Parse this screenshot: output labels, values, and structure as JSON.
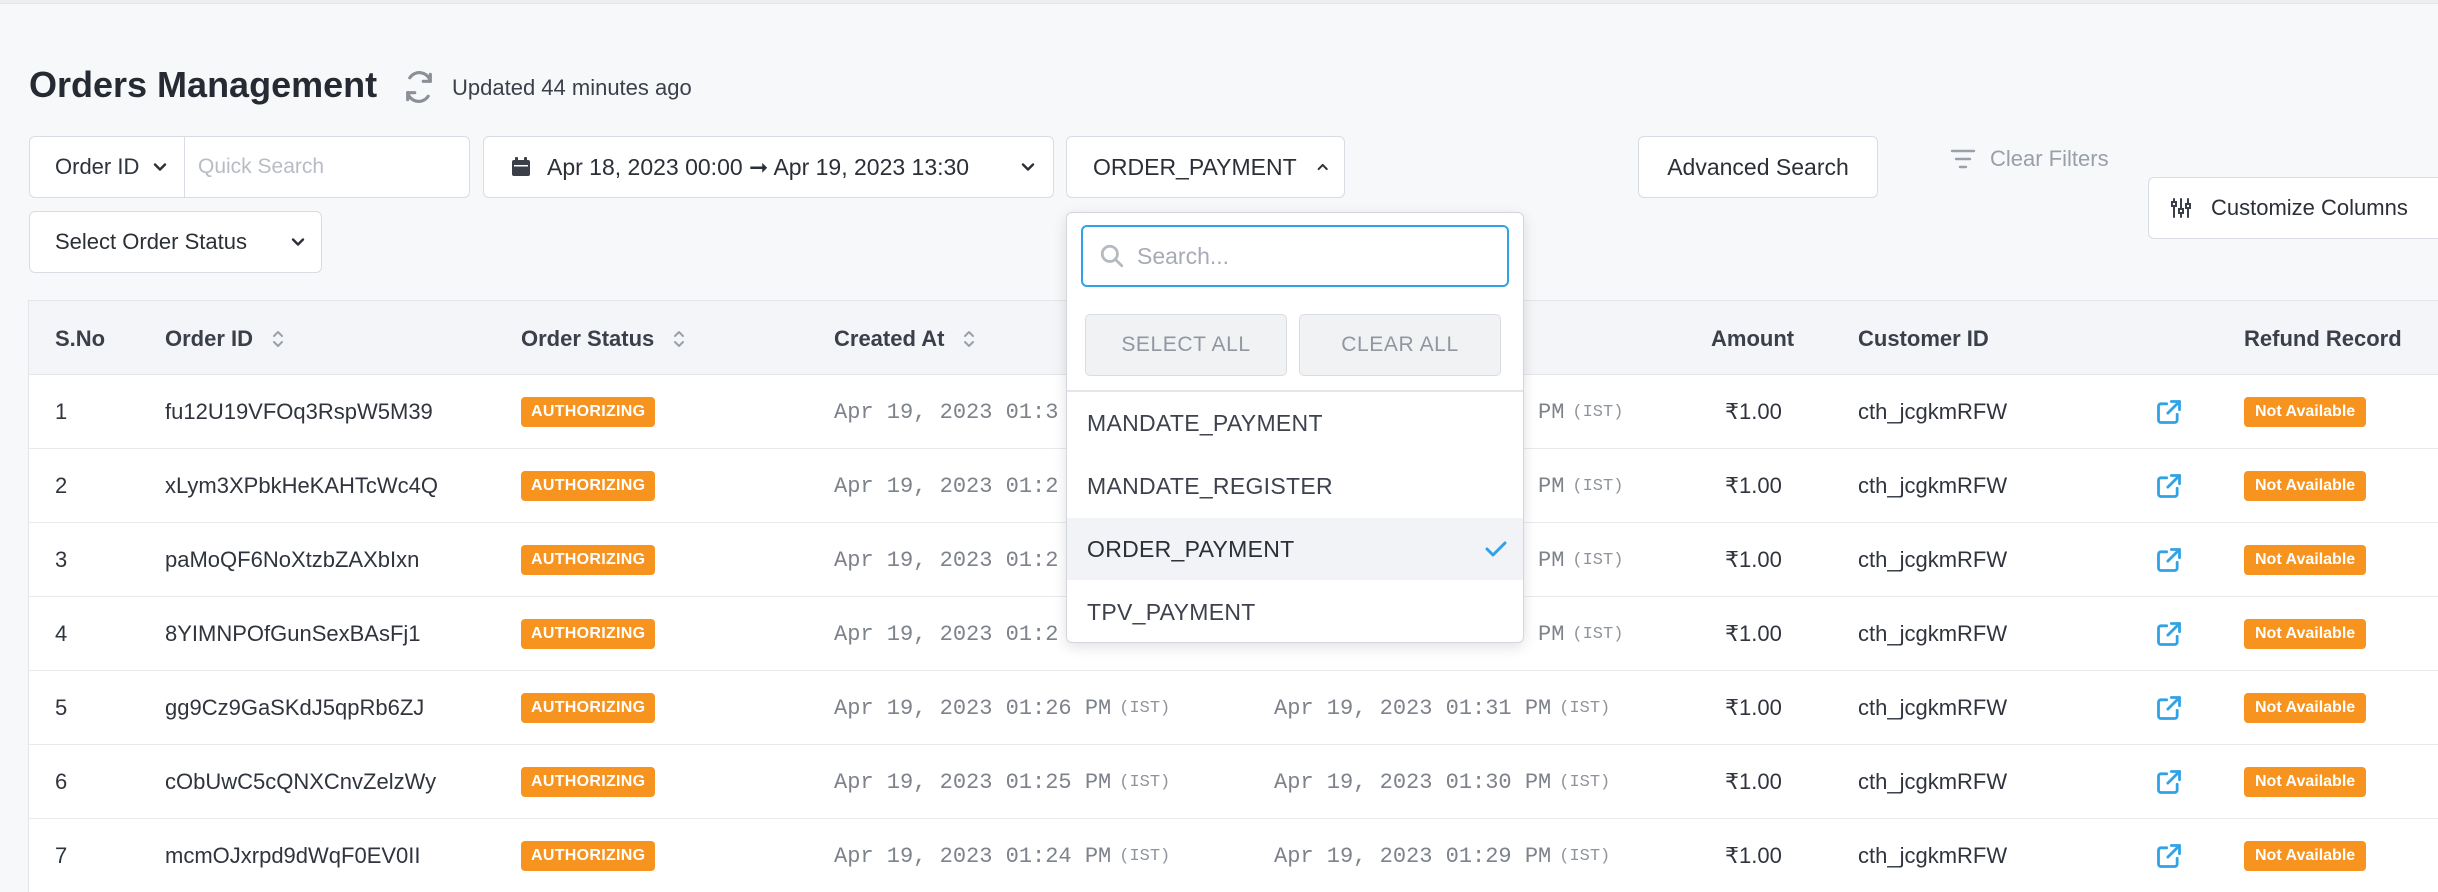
{
  "header": {
    "title": "Orders Management",
    "updated": "Updated 44 minutes ago"
  },
  "filters": {
    "id_type": "Order ID",
    "quick_search_placeholder": "Quick Search",
    "date_range": "Apr 18, 2023 00:00 ➞ Apr 19, 2023 13:30",
    "order_type": "ORDER_PAYMENT",
    "advanced_search": "Advanced Search",
    "clear_filters": "Clear Filters",
    "customize_columns": "Customize Columns",
    "order_status": "Select Order Status"
  },
  "dropdown": {
    "search_placeholder": "Search...",
    "select_all": "SELECT ALL",
    "clear_all": "CLEAR ALL",
    "options": [
      {
        "label": "MANDATE_PAYMENT",
        "selected": false
      },
      {
        "label": "MANDATE_REGISTER",
        "selected": false
      },
      {
        "label": "ORDER_PAYMENT",
        "selected": true
      },
      {
        "label": "TPV_PAYMENT",
        "selected": false
      }
    ]
  },
  "table": {
    "columns": {
      "sno": "S.No",
      "order_id": "Order ID",
      "order_status": "Order Status",
      "created_at": "Created At",
      "amount": "Amount",
      "customer_id": "Customer ID",
      "refund_record": "Refund Record"
    },
    "tz": "(IST)",
    "rows": [
      {
        "sno": "1",
        "order_id": "fu12U19VFOq3RspW5M39",
        "status": "AUTHORIZING",
        "created": "Apr 19, 2023 01:3",
        "updated": "PM",
        "amount": "₹1.00",
        "customer": "cth_jcgkmRFW",
        "refund": "Not Available"
      },
      {
        "sno": "2",
        "order_id": "xLym3XPbkHeKAHTcWc4Q",
        "status": "AUTHORIZING",
        "created": "Apr 19, 2023 01:2",
        "updated": "PM",
        "amount": "₹1.00",
        "customer": "cth_jcgkmRFW",
        "refund": "Not Available"
      },
      {
        "sno": "3",
        "order_id": "paMoQF6NoXtzbZAXbIxn",
        "status": "AUTHORIZING",
        "created": "Apr 19, 2023 01:2",
        "updated": "PM",
        "amount": "₹1.00",
        "customer": "cth_jcgkmRFW",
        "refund": "Not Available"
      },
      {
        "sno": "4",
        "order_id": "8YIMNPOfGunSexBAsFj1",
        "status": "AUTHORIZING",
        "created": "Apr 19, 2023 01:2",
        "updated": "PM",
        "amount": "₹1.00",
        "customer": "cth_jcgkmRFW",
        "refund": "Not Available"
      },
      {
        "sno": "5",
        "order_id": "gg9Cz9GaSKdJ5qpRb6ZJ",
        "status": "AUTHORIZING",
        "created": "Apr 19, 2023 01:26 PM",
        "updated": "Apr 19, 2023 01:31 PM",
        "amount": "₹1.00",
        "customer": "cth_jcgkmRFW",
        "refund": "Not Available"
      },
      {
        "sno": "6",
        "order_id": "cObUwC5cQNXCnvZelzWy",
        "status": "AUTHORIZING",
        "created": "Apr 19, 2023 01:25 PM",
        "updated": "Apr 19, 2023 01:30 PM",
        "amount": "₹1.00",
        "customer": "cth_jcgkmRFW",
        "refund": "Not Available"
      },
      {
        "sno": "7",
        "order_id": "mcmOJxrpd9dWqF0EV0II",
        "status": "AUTHORIZING",
        "created": "Apr 19, 2023 01:24 PM",
        "updated": "Apr 19, 2023 01:29 PM",
        "amount": "₹1.00",
        "customer": "cth_jcgkmRFW",
        "refund": "Not Available"
      }
    ]
  },
  "colors": {
    "badge": "#f79420",
    "link_icon": "#2fa3e6",
    "focus_border": "#2fa3e6"
  }
}
